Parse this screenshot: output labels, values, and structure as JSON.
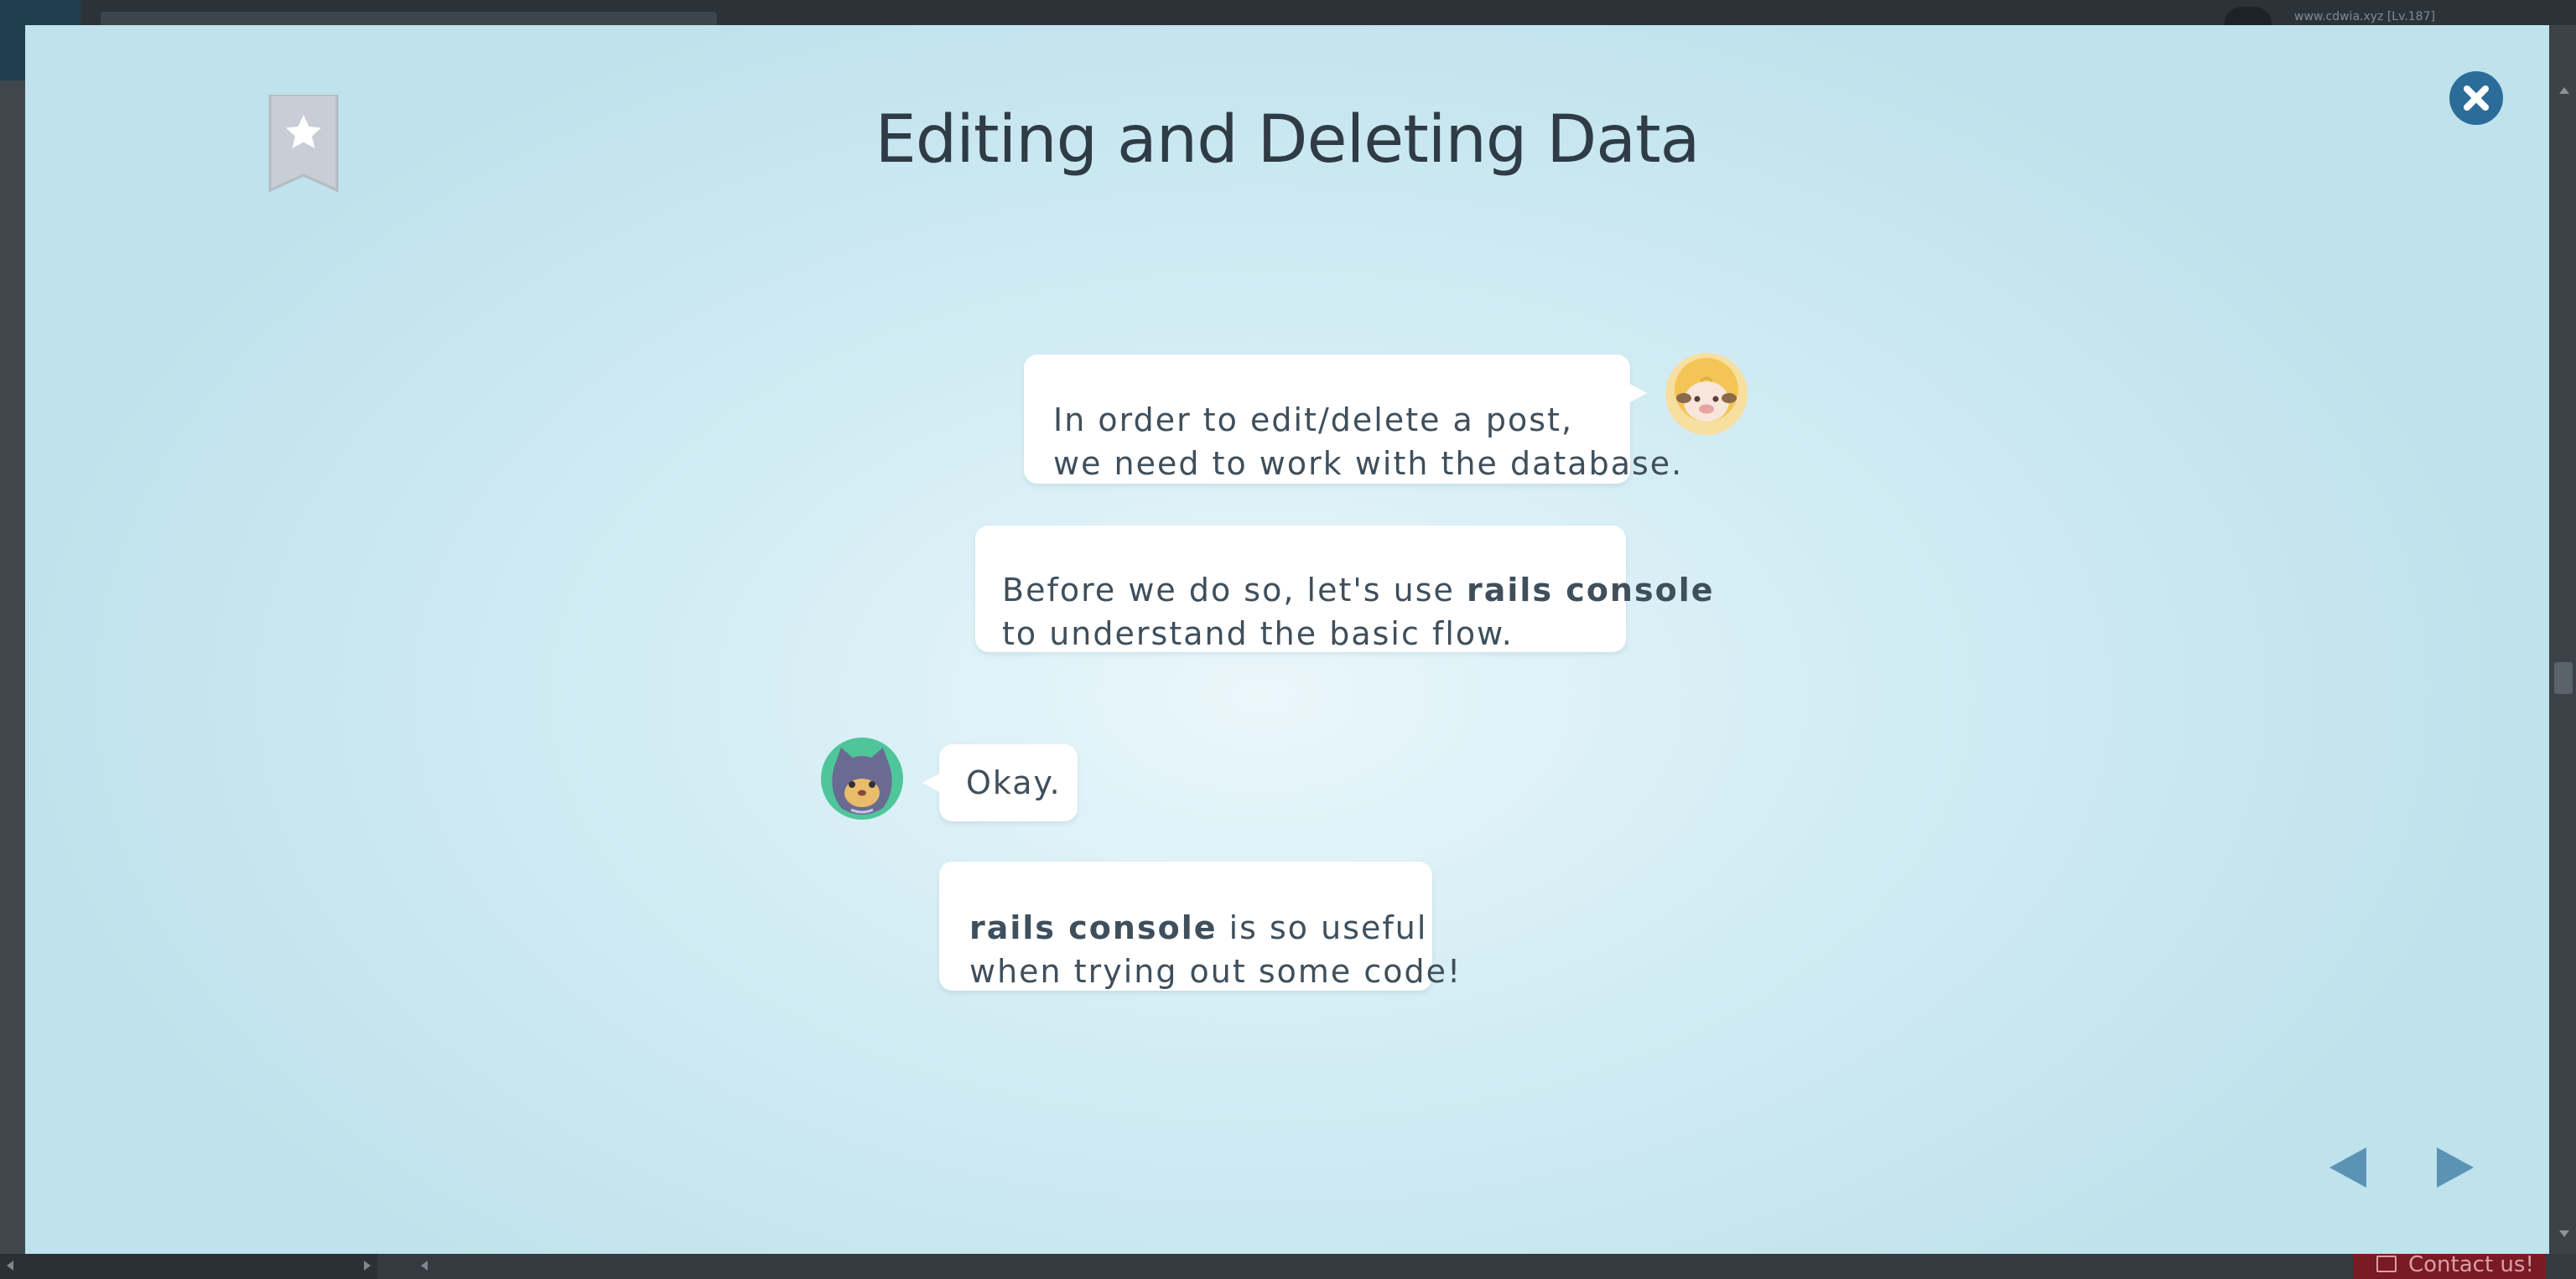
{
  "background_page": {
    "username": "www.cdwia.xyz [Lv.187]",
    "contact_label": "Contact us!",
    "icons": [
      "logo-icon",
      "avatar-icon",
      "envelope-icon"
    ]
  },
  "modal": {
    "title": "Editing and Deleting Data",
    "icons": {
      "bookmark": "bookmark-star-icon",
      "close": "close-icon",
      "prev": "triangle-left-icon",
      "next": "triangle-right-icon"
    },
    "colors": {
      "title": "#2f3b45",
      "bubble_text": "#3f4f5c",
      "close_button": "#2b6c98",
      "nav_arrows": "#5b93b5"
    },
    "conversation": [
      {
        "speaker": "sheep",
        "lines": [
          {
            "text": "In order to edit/delete a post,"
          },
          {
            "text": "we need to work with the database."
          }
        ]
      },
      {
        "speaker": "sheep",
        "lines": [
          {
            "before": "Before we do so, let's use ",
            "bold": "rails console",
            "after": ""
          },
          {
            "text": "to understand the basic flow."
          }
        ]
      },
      {
        "speaker": "cat",
        "lines": [
          {
            "text": "Okay."
          }
        ]
      },
      {
        "speaker": "cat",
        "lines": [
          {
            "before": "",
            "bold": "rails console",
            "after": " is so useful"
          },
          {
            "text": "when trying out some code!"
          }
        ]
      }
    ]
  }
}
